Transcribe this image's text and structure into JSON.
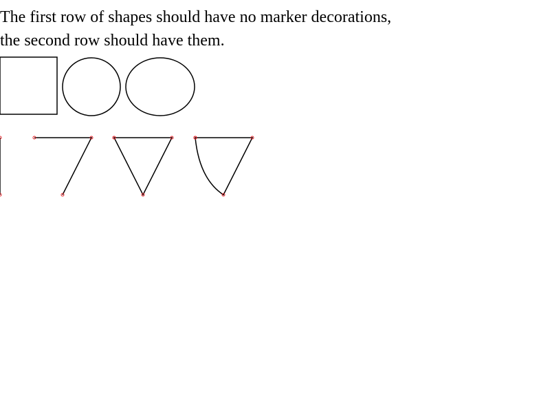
{
  "caption": {
    "line1": "The first row of shapes should have no marker decorations,",
    "line2": "the second row should have them."
  },
  "colors": {
    "stroke": "#000000",
    "marker": "#e8262d",
    "background": "#ffffff"
  }
}
